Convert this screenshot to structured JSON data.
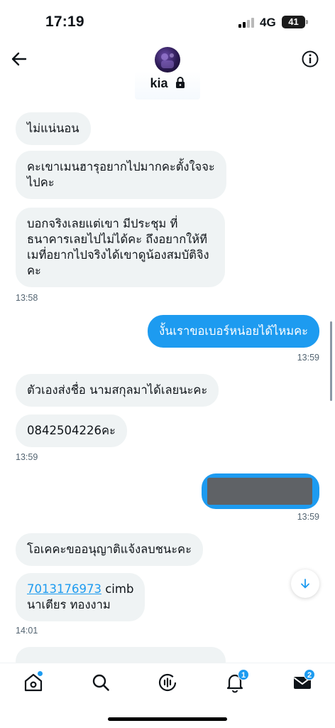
{
  "status_bar": {
    "time": "17:19",
    "network": "4G",
    "battery": "41"
  },
  "header": {
    "contact_name": "kia"
  },
  "messages": [
    {
      "text": "ไม่แน่นอน"
    },
    {
      "text": "คะเขาเมนฮารุอยากไปมากคะตั้งใจจะไปคะ"
    },
    {
      "text": "บอกจริงเลยแต่เขา มีประชุม ที่ธนาคารเลยไปไม่ได้คะ ถึงอยากให้ทีเมที่อยากไปจริงได้เขาดูน้องสมบัติจิงคะ",
      "time": "13:58"
    },
    {
      "text": "งั้นเราขอเบอร์หน่อยได้ไหมคะ",
      "time": "13:59"
    },
    {
      "text": "ตัวเองส่งชื่อ นามสกุลมาได้เลยนะคะ"
    },
    {
      "text": "0842504226คะ",
      "time": "13:59"
    },
    {
      "text": "",
      "time": "13:59"
    },
    {
      "text": "โอเคคะขออนุญาติแจ้งลบชนะคะ"
    },
    {
      "account": "7013176973",
      "bank": "cimb",
      "name": "นาเตียร ทองงาม",
      "time": "14:01"
    }
  ],
  "nav": {
    "notifications_badge": "1",
    "messages_badge": "2"
  },
  "icons": {
    "back": "arrow-left-icon",
    "info": "info-icon",
    "lock": "lock-icon",
    "scroll_down": "arrow-down-icon",
    "home": "home-icon",
    "search": "search-icon",
    "grok": "spaces-icon",
    "notifications": "bell-icon",
    "messages": "envelope-icon"
  },
  "colors": {
    "accent": "#1d9bf0",
    "incoming_bubble": "#eff3f4",
    "text": "#0f1419",
    "muted": "#536471"
  }
}
